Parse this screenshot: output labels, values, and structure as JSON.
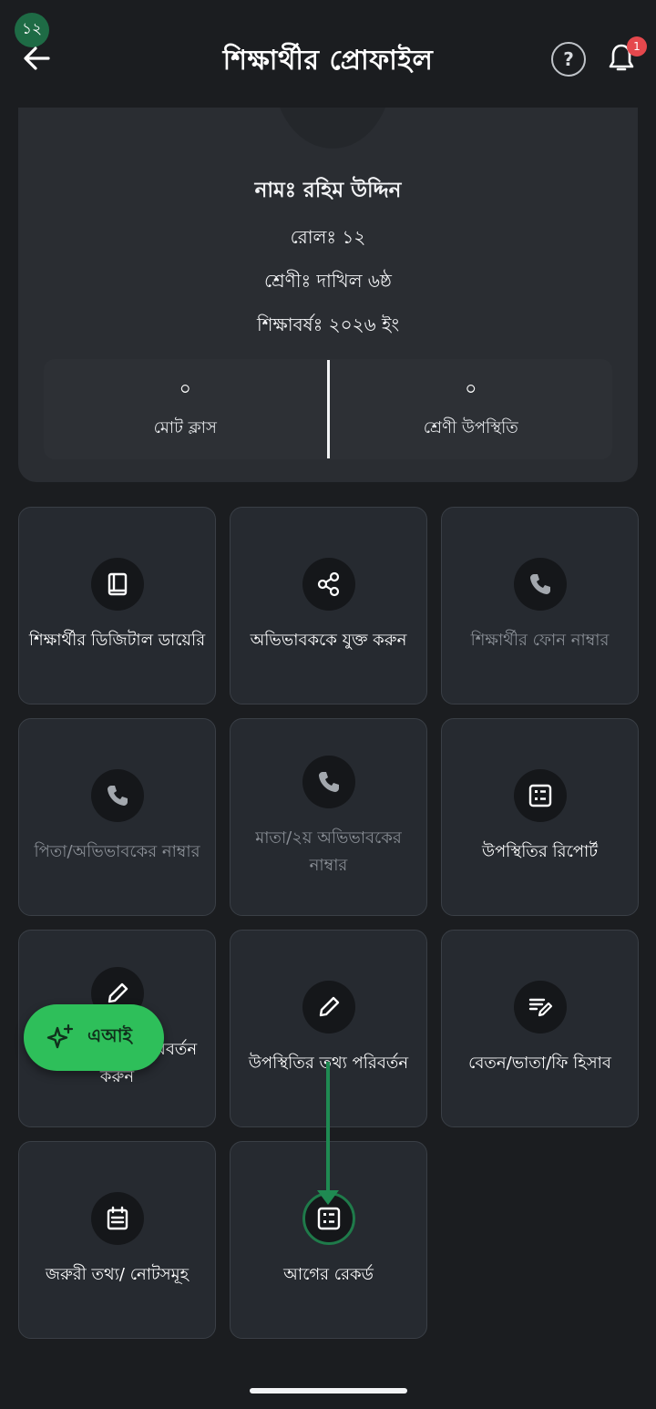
{
  "status_badge": "১২",
  "header": {
    "title": "শিক্ষার্থীর প্রোফাইল",
    "help_symbol": "?",
    "notification_count": "1"
  },
  "profile": {
    "name": "নামঃ রহিম উদ্দিন",
    "roll": "রোলঃ ১২",
    "class": "শ্রেণীঃ দাখিল ৬ষ্ঠ",
    "academic_year": "শিক্ষাবর্ষঃ ২০২৬ ইং",
    "stats": [
      {
        "value": "০",
        "label": "মোট ক্লাস"
      },
      {
        "value": "০",
        "label": "শ্রেণী উপস্থিতি"
      }
    ]
  },
  "tiles": [
    {
      "label": "শিক্ষার্থীর ডিজিটাল ডায়েরি",
      "icon": "book-icon",
      "dim": false
    },
    {
      "label": "অভিভাবককে যুক্ত করুন",
      "icon": "share-icon",
      "dim": false
    },
    {
      "label": "শিক্ষার্থীর ফোন নাম্বার",
      "icon": "phone-icon",
      "dim": true
    },
    {
      "label": "পিতা/অভিভাবকের নাম্বার",
      "icon": "phone-icon",
      "dim": true
    },
    {
      "label": "মাতা/২য় অভিভাবকের নাম্বার",
      "icon": "phone-icon",
      "dim": true
    },
    {
      "label": "উপস্থিতির রিপোর্ট",
      "icon": "report-icon",
      "dim": false
    },
    {
      "label": "উপস্থিতির তথ্য পরিবর্তন করুন",
      "icon": "pencil-icon",
      "dim": false
    },
    {
      "label": "উপস্থিতির তথ্য পরিবর্তন",
      "icon": "pencil-icon",
      "dim": false
    },
    {
      "label": "বেতন/ভাতা/ফি হিসাব",
      "icon": "edit-note-icon",
      "dim": false
    },
    {
      "label": "জরুরী তথ্য/ নোটসমূহ",
      "icon": "notes-icon",
      "dim": false
    },
    {
      "label": "আগের রেকর্ড",
      "icon": "record-icon",
      "dim": false
    }
  ],
  "ai_button": {
    "label": "এআই",
    "icon": "sparkle-icon"
  },
  "colors": {
    "background": "#1b1d20",
    "card": "#2a2d32",
    "tile": "#262a30",
    "accent_green": "#2ebf5a",
    "badge_red": "#e5484d"
  }
}
